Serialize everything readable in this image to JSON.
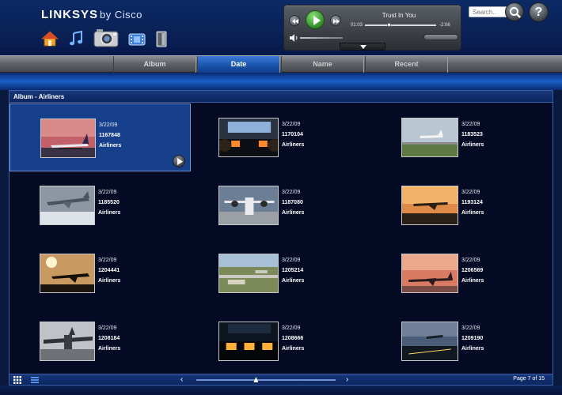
{
  "brand": {
    "name": "LINKSYS",
    "suffix": "by Cisco"
  },
  "nav": {
    "icons": [
      "home-icon",
      "music-icon",
      "photo-camera-icon",
      "video-icon",
      "device-icon"
    ]
  },
  "player": {
    "track_title": "Trust In You",
    "elapsed": "01:03",
    "remaining": "-2:06",
    "progress": 0.34,
    "volume": 0.2
  },
  "search": {
    "placeholder": "Search..",
    "help_label": "?"
  },
  "tabs": [
    {
      "label": "Album",
      "state": "normal"
    },
    {
      "label": "Date",
      "state": "selected"
    },
    {
      "label": "Name",
      "state": "inactive"
    },
    {
      "label": "Recent",
      "state": "inactive"
    }
  ],
  "panel": {
    "title": "Album - Airliners"
  },
  "photos": [
    {
      "date": "3/22/09",
      "id": "1167848",
      "album": "Airliners",
      "selected": true,
      "scene": "sunset-runway"
    },
    {
      "date": "3/22/09",
      "id": "1170104",
      "album": "Airliners",
      "selected": false,
      "scene": "cockpit"
    },
    {
      "date": "3/22/09",
      "id": "1183523",
      "album": "Airliners",
      "selected": false,
      "scene": "landing-day"
    },
    {
      "date": "3/22/09",
      "id": "1185520",
      "album": "Airliners",
      "selected": false,
      "scene": "snow-takeoff"
    },
    {
      "date": "3/22/09",
      "id": "1187080",
      "album": "Airliners",
      "selected": false,
      "scene": "prop-plane"
    },
    {
      "date": "3/22/09",
      "id": "1193124",
      "album": "Airliners",
      "selected": false,
      "scene": "dusk-plane"
    },
    {
      "date": "3/22/09",
      "id": "1204441",
      "album": "Airliners",
      "selected": false,
      "scene": "silhouette-sky"
    },
    {
      "date": "3/22/09",
      "id": "1205214",
      "album": "Airliners",
      "selected": false,
      "scene": "aerial-airport"
    },
    {
      "date": "3/22/09",
      "id": "1206569",
      "album": "Airliners",
      "selected": false,
      "scene": "sunset-flyby"
    },
    {
      "date": "3/22/09",
      "id": "1208184",
      "album": "Airliners",
      "selected": false,
      "scene": "cargo-plane"
    },
    {
      "date": "3/22/09",
      "id": "1208666",
      "album": "Airliners",
      "selected": false,
      "scene": "night-cockpit"
    },
    {
      "date": "3/22/09",
      "id": "1209190",
      "album": "Airliners",
      "selected": false,
      "scene": "night-runway"
    }
  ],
  "pagination": {
    "label": "Page 7 of 15",
    "current": 7,
    "total": 15
  },
  "colors": {
    "header_bg": "#0a2257",
    "tab_selected": "#1b55ad",
    "panel_bg": "#050a24",
    "cell_selected": "#163f8c",
    "play_green": "#2f8a25"
  }
}
